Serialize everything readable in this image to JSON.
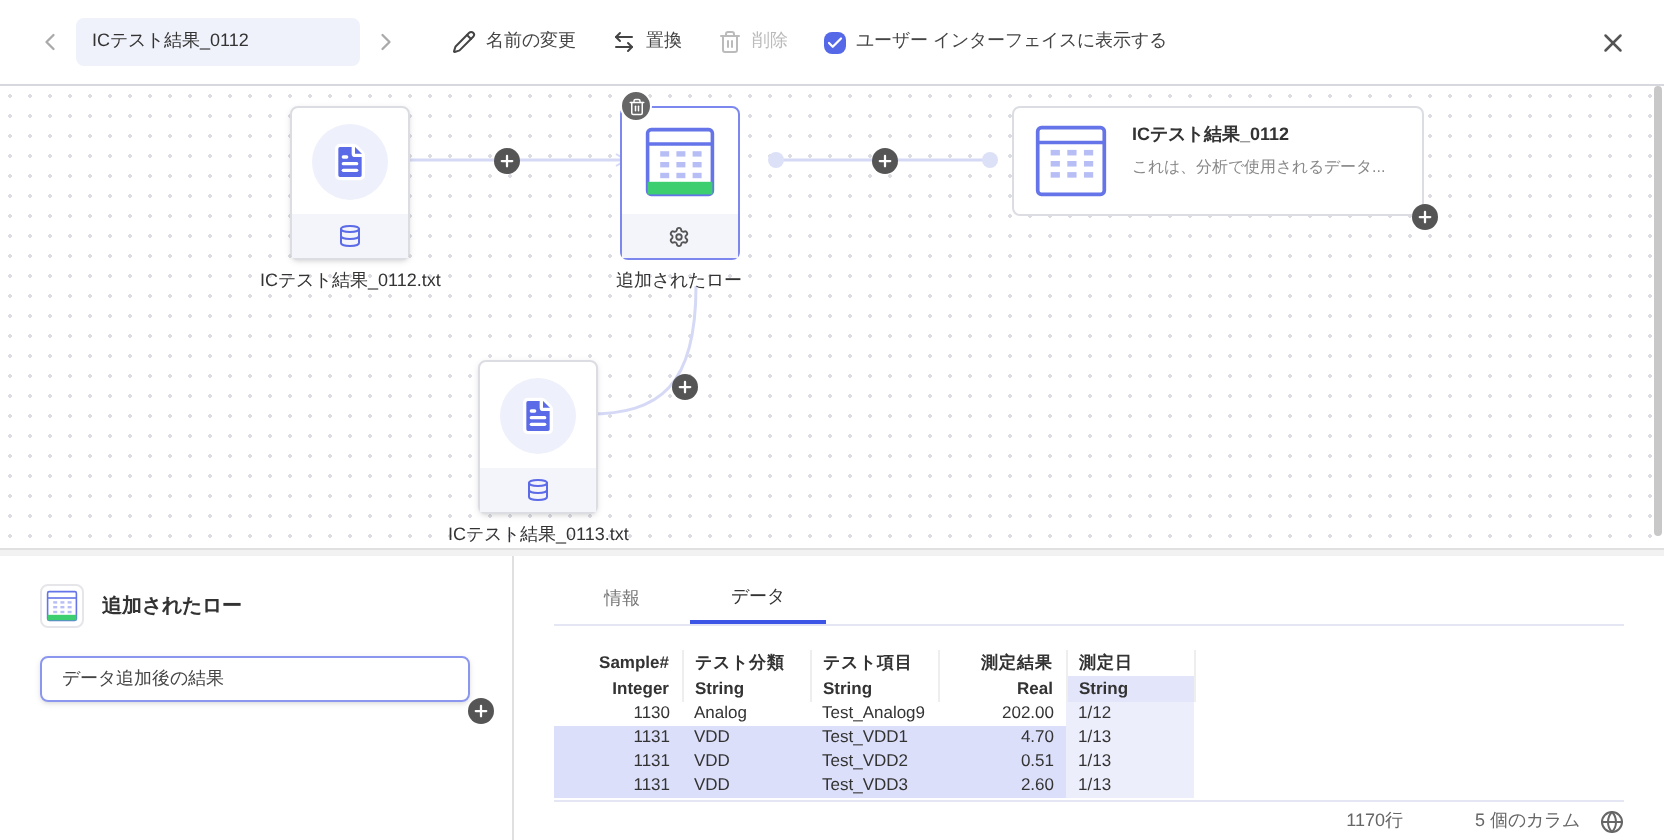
{
  "toolbar": {
    "title_field": "ICテスト結果_0112",
    "actions": [
      {
        "kind": "rename",
        "label": "名前の変更",
        "disabled": false
      },
      {
        "kind": "replace",
        "label": "置換",
        "disabled": false
      },
      {
        "kind": "delete",
        "label": "削除",
        "disabled": true
      }
    ],
    "show_in_ui": {
      "label": "ユーザー インターフェイスに表示する",
      "checked": true
    }
  },
  "canvas": {
    "sources": [
      {
        "label": "ICテスト結果_0112.txt"
      },
      {
        "label": "ICテスト結果_0113.txt"
      }
    ],
    "transform": {
      "label": "追加されたロー",
      "selected": true
    },
    "result": {
      "title": "ICテスト結果_0112",
      "description": "これは、分析で使用されるデータ..."
    }
  },
  "detail": {
    "title": "追加されたロー",
    "description_field": "データ追加後の結果",
    "tabs": [
      {
        "label": "情報",
        "selected": false
      },
      {
        "label": "データ",
        "selected": true
      }
    ],
    "table": {
      "columns": [
        {
          "name": "Sample#",
          "type": "Integer",
          "kind": "number",
          "selected": false
        },
        {
          "name": "テスト分類",
          "type": "String",
          "kind": "text",
          "selected": false
        },
        {
          "name": "テスト項目",
          "type": "String",
          "kind": "text",
          "selected": false
        },
        {
          "name": "測定結果",
          "type": "Real",
          "kind": "number",
          "selected": false
        },
        {
          "name": "測定日",
          "type": "String",
          "kind": "text",
          "selected": true
        }
      ],
      "rows": [
        {
          "selected": false,
          "cells": [
            "1130",
            "Analog",
            "Test_Analog9",
            "202.00",
            "1/12"
          ]
        },
        {
          "selected": true,
          "cells": [
            "1131",
            "VDD",
            "Test_VDD1",
            "4.70",
            "1/13"
          ]
        },
        {
          "selected": true,
          "cells": [
            "1131",
            "VDD",
            "Test_VDD2",
            "0.51",
            "1/13"
          ]
        },
        {
          "selected": true,
          "cells": [
            "1131",
            "VDD",
            "Test_VDD3",
            "2.60",
            "1/13"
          ]
        }
      ]
    },
    "row_count": "1170行",
    "column_count": "5 個のカラム"
  }
}
